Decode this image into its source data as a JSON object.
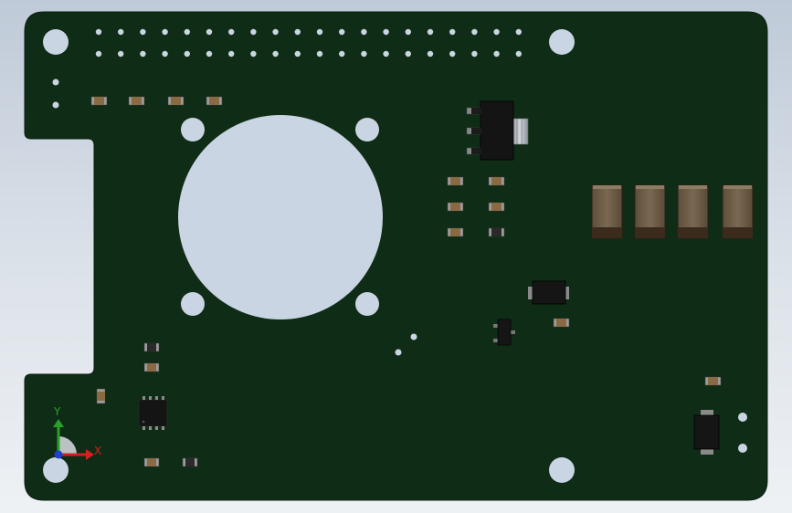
{
  "viewport": {
    "background_top": "#bfcad8",
    "background_bottom": "#eef1f4"
  },
  "board": {
    "color": "#0f2c16",
    "hole_color": "#c9d5e2"
  },
  "triad": {
    "x_label": "X",
    "y_label": "Y",
    "x_color": "#d42020",
    "y_color": "#2aa02a",
    "z_color": "#1f3fd0"
  },
  "components": {
    "header_pin_count_per_row": 20,
    "smd_resistor_color": "#8a6a42",
    "ic_color": "#141414",
    "inductor_color": "#6b5a44"
  }
}
